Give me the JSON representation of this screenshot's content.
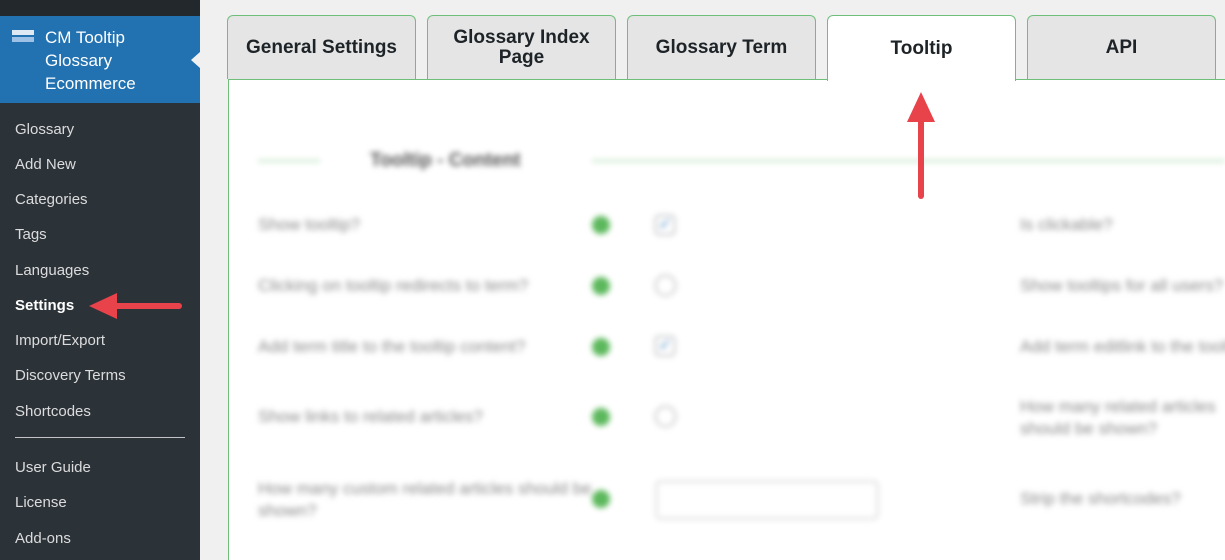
{
  "sidebar": {
    "plugin_title": "CM Tooltip Glossary Ecommerce",
    "items": [
      {
        "label": "Glossary"
      },
      {
        "label": "Add New"
      },
      {
        "label": "Categories"
      },
      {
        "label": "Tags"
      },
      {
        "label": "Languages"
      },
      {
        "label": "Settings"
      },
      {
        "label": "Import/Export"
      },
      {
        "label": "Discovery Terms"
      },
      {
        "label": "Shortcodes"
      },
      {
        "label": "User Guide"
      },
      {
        "label": "License"
      },
      {
        "label": "Add-ons"
      }
    ]
  },
  "tabs": [
    {
      "label": "General Settings"
    },
    {
      "label": "Glossary Index Page"
    },
    {
      "label": "Glossary Term"
    },
    {
      "label": "Tooltip"
    },
    {
      "label": "API"
    }
  ],
  "content": {
    "section_title": "Tooltip - Content",
    "rows": [
      {
        "label": "Show tooltip?",
        "right_label": "Is clickable?"
      },
      {
        "label": "Clicking on tooltip redirects to term?",
        "right_label": "Show tooltips for all users?"
      },
      {
        "label": "Add term title to the tooltip content?",
        "right_label": "Add term editlink to the tooltip?"
      },
      {
        "label": "Show links to related articles?",
        "right_label": "How many related articles should be shown?"
      },
      {
        "label": "How many custom related articles should be shown?",
        "right_label": "Strip the shortcodes?"
      }
    ]
  },
  "colors": {
    "sidebar_bg": "#2c3338",
    "active_plugin_bg": "#2271b1",
    "tab_border": "#6fbf7a",
    "arrow": "#e8424b"
  }
}
